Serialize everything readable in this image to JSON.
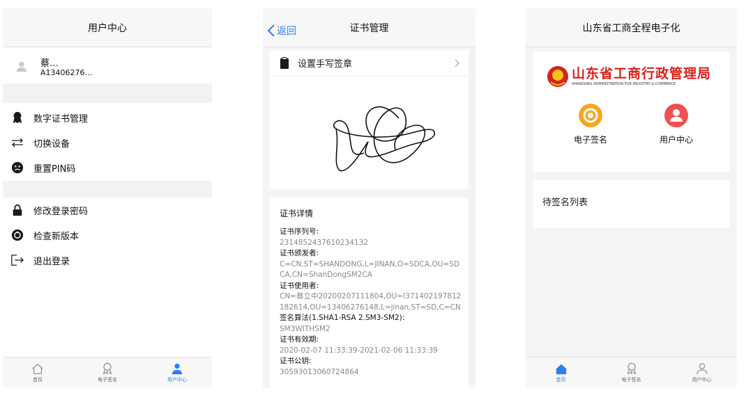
{
  "panel1": {
    "title": "用户中心",
    "user_name": "蔡…",
    "user_id": "A13406276…",
    "menu": [
      {
        "icon": "ribbon-icon",
        "label": "数字证书管理"
      },
      {
        "icon": "swap-icon",
        "label": "切换设备"
      },
      {
        "icon": "reset-icon",
        "label": "重置PIN码"
      },
      {
        "icon": "lock-icon",
        "label": "修改登录密码"
      },
      {
        "icon": "update-icon",
        "label": "检查新版本"
      },
      {
        "icon": "logout-icon",
        "label": "退出登录"
      }
    ],
    "tabs": [
      "首页",
      "电子签名",
      "用户中心"
    ],
    "active_tab": 2
  },
  "panel2": {
    "back_label": "返回",
    "title": "证书管理",
    "set_signature_label": "设置手写签章",
    "details_title": "证书详情",
    "details": [
      {
        "key": "证书序列号:",
        "value": "2314852437610234132"
      },
      {
        "key": "证书颁发者:",
        "value": "C=CN,ST=SHANDONG,L=JINAN,O=SDCA,OU=SDCA,CN=ShanDongSM2CA"
      },
      {
        "key": "证书使用者:",
        "value": "CN=蔡立中20200207111804,OU=I371402197812182614,OU=13406276148,L=jinan,ST=SD,C=CN"
      },
      {
        "key": "签名算法(1.SHA1-RSA 2.SM3-SM2):",
        "value": "SM3WITHSM2"
      },
      {
        "key": "证书有效期:",
        "value": "2020-02-07 11:33:39-2021-02-06 11:33:39"
      },
      {
        "key": "证书公钥:",
        "value": "30593013060724864"
      }
    ]
  },
  "panel3": {
    "title": "山东省工商全程电子化",
    "logo_text": "山东省工商行政管理局",
    "logo_subtext": "SHANDONG ADMINISTRATION FOR INDUSTRY & COMMERCE",
    "tiles": [
      {
        "icon": "medal-icon",
        "label": "电子签名",
        "color": "#f5a623"
      },
      {
        "icon": "user-icon",
        "label": "用户中心",
        "color": "#f0504f"
      }
    ],
    "pending_title": "待签名列表",
    "tabs": [
      "首页",
      "电子签名",
      "用户中心"
    ],
    "active_tab": 0
  },
  "colors": {
    "accent": "#2f7cf6",
    "logo_red": "#d8211c"
  }
}
